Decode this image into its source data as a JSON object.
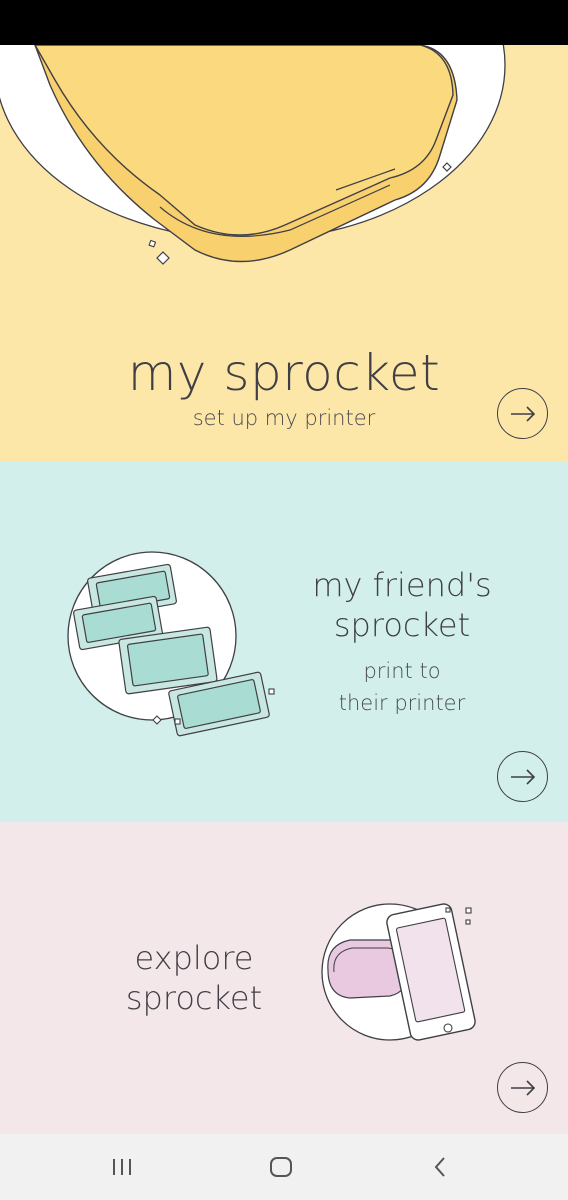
{
  "colors": {
    "card1_bg": "#fde7a8",
    "card2_bg": "#d2efec",
    "card3_bg": "#f4e7ea",
    "printer_yellow": "#fbd97e",
    "print_teal": "#a9ddd4",
    "printer_pink": "#e8c9df",
    "text": "#3f3f45",
    "nav_bg": "#f1f1f1"
  },
  "cards": [
    {
      "title": "my sprocket",
      "subtitle": "set up my printer",
      "icon": "arrow-right-icon"
    },
    {
      "title_line1": "my friend's",
      "title_line2": "sprocket",
      "subtitle_line1": "print to",
      "subtitle_line2": "their printer",
      "icon": "arrow-right-icon"
    },
    {
      "title_line1": "explore",
      "title_line2": "sprocket",
      "icon": "arrow-right-icon"
    }
  ],
  "nav": {
    "icons": [
      "recent-apps-icon",
      "home-icon",
      "back-icon"
    ]
  }
}
